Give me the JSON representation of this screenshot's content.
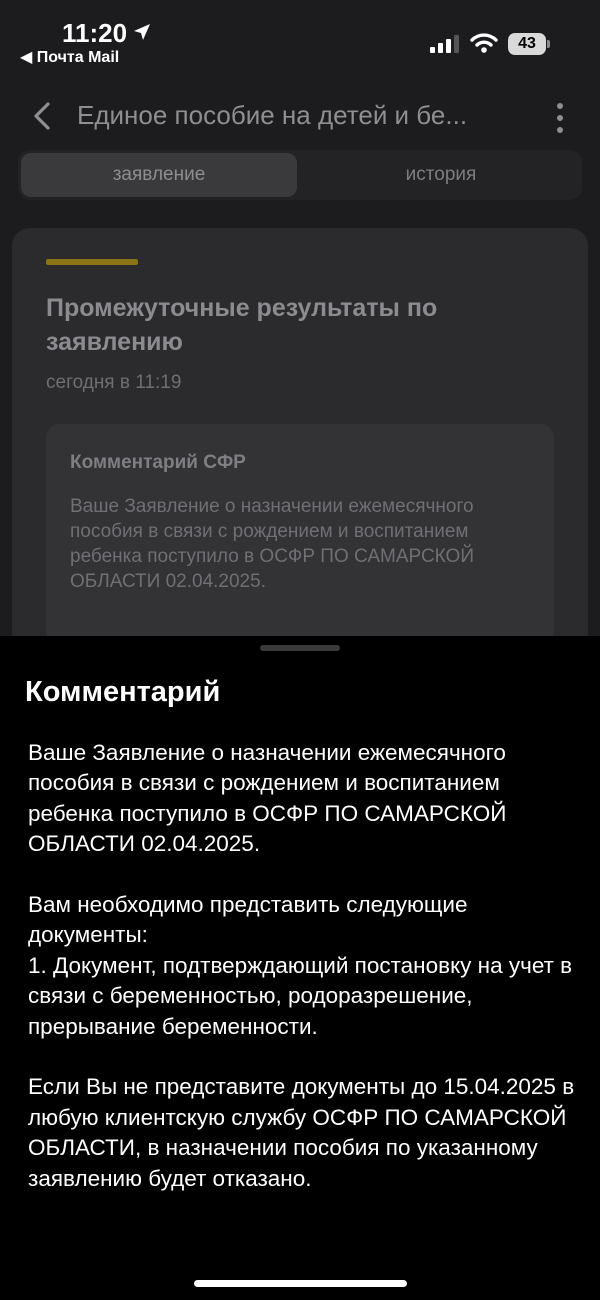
{
  "status_bar": {
    "time": "11:20",
    "back_app": "◀ Почта Mail",
    "battery": "43"
  },
  "header": {
    "title": "Единое пособие на детей и бе..."
  },
  "tabs": [
    {
      "label": "заявление",
      "active": true
    },
    {
      "label": "история",
      "active": false
    }
  ],
  "card": {
    "title": "Промежуточные результаты по заявлению",
    "date": "сегодня в 11:19",
    "comment_title": "Комментарий СФР",
    "comment_text": "Ваше Заявление о назначении ежемесячного пособия в связи с рождением и воспитанием ребенка поступило в ОСФР ПО САМАРСКОЙ ОБЛАСТИ 02.04.2025."
  },
  "sheet": {
    "title": "Комментарий",
    "paragraphs": [
      "Ваше Заявление о назначении ежемесячного пособия в связи с рождением и воспитанием ребенка поступило в ОСФР ПО САМАРСКОЙ ОБЛАСТИ 02.04.2025.",
      "Вам необходимо представить следующие документы:",
      "1. Документ, подтверждающий постановку на учет в связи с беременностью, родоразрешение, прерывание беременности.",
      "Если Вы не представите документы до 15.04.2025 в любую клиентскую службу ОСФР ПО САМАРСКОЙ ОБЛАСТИ, в назначении пособия по указанному заявлению будет отказано."
    ]
  },
  "colors": {
    "accent": "#8c7414",
    "background": "#000000",
    "card": "#2b2b2d"
  }
}
